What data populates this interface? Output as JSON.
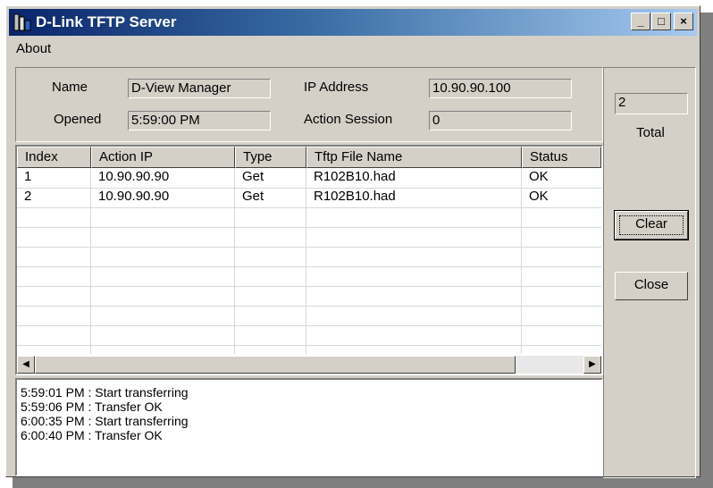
{
  "window": {
    "title": "D-Link TFTP Server"
  },
  "title_buttons": {
    "minimize": "_",
    "maximize": "□",
    "close": "×"
  },
  "menu": {
    "about": "About"
  },
  "info": {
    "name_label": "Name",
    "name_value": "D-View Manager",
    "ip_label": "IP Address",
    "ip_value": "10.90.90.100",
    "opened_label": "Opened",
    "opened_value": "5:59:00 PM",
    "session_label": "Action Session",
    "session_value": "0"
  },
  "table": {
    "headers": [
      "Index",
      "Action IP",
      "Type",
      "Tftp File Name",
      "Status"
    ],
    "rows": [
      [
        "1",
        "10.90.90.90",
        "Get",
        "R102B10.had",
        "OK"
      ],
      [
        "2",
        "10.90.90.90",
        "Get",
        "R102B10.had",
        "OK"
      ]
    ]
  },
  "log": [
    "5:59:01 PM : Start transferring",
    "5:59:06 PM : Transfer OK",
    "6:00:35 PM : Start transferring",
    "6:00:40 PM : Transfer OK"
  ],
  "side": {
    "total_value": "2",
    "total_label": "Total",
    "clear_label": "Clear",
    "close_label": "Close"
  },
  "icons": {
    "app": "dlink-server-icon",
    "scroll_left": "arrow-left-icon",
    "scroll_right": "arrow-right-icon"
  }
}
